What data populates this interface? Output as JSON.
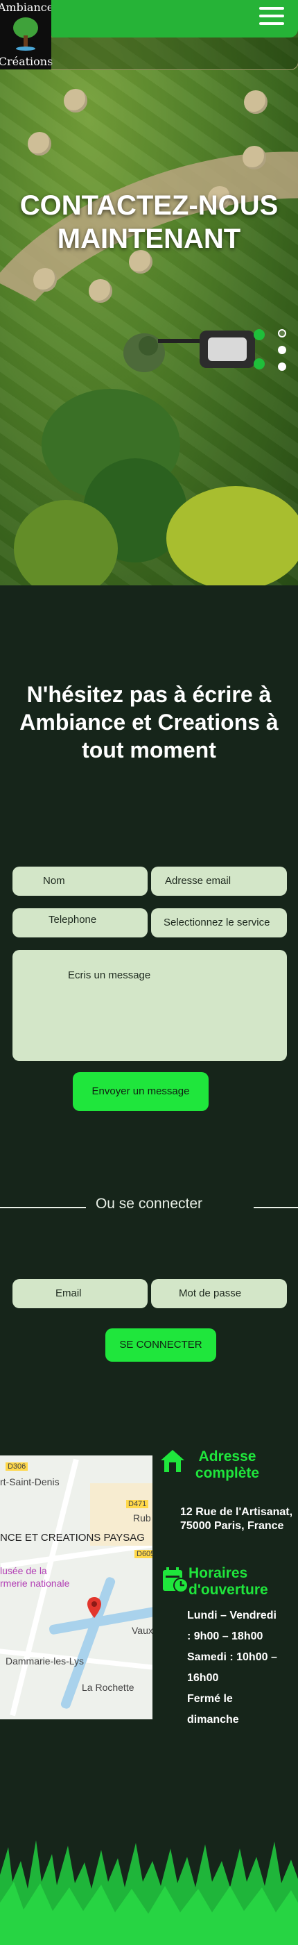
{
  "header": {
    "logo_line1": "Ambiance",
    "logo_line2": "Créations",
    "menu_icon": "hamburger-menu-icon"
  },
  "hero": {
    "title": "CONTACTEZ-NOUS MAINTENANT",
    "slides_total": 3,
    "active_slide": 1
  },
  "contact": {
    "intro": "N'hésitez pas à écrire à Ambiance et Creations à tout moment",
    "name_placeholder": "Nom",
    "email_placeholder": "Adresse email",
    "phone_placeholder": "Telephone",
    "service_placeholder": "Selectionnez le service",
    "message_placeholder": "Ecris un message",
    "submit_label": "Envoyer un message"
  },
  "login": {
    "divider_label": "Ou se connecter",
    "email_placeholder": "Email",
    "password_placeholder": "Mot de passe",
    "submit_label": "SE CONNECTER"
  },
  "map": {
    "labels": [
      "D306",
      "rt-Saint-Denis",
      "D471",
      "Rub",
      "NCE ET CREATIONS PAYSAG",
      "D605",
      "lusée de la",
      "rmerie nationale",
      "Vaux",
      "Dammarie-les-Lys",
      "La Rochette"
    ]
  },
  "address": {
    "icon": "home-icon",
    "title": "Adresse complète",
    "text": "12 Rue de l'Artisanat, 75000 Paris, France"
  },
  "hours": {
    "icon": "calendar-clock-icon",
    "title": "Horaires d'ouverture",
    "lines": [
      "Lundi – Vendredi",
      ": 9h00 – 18h00",
      "Samedi : 10h00 –",
      "16h00",
      "Fermé le",
      "dimanche"
    ]
  },
  "colors": {
    "background": "#16251a",
    "accent": "#1fe63c",
    "field": "#d3e6c8",
    "navbar": "#26b337"
  }
}
